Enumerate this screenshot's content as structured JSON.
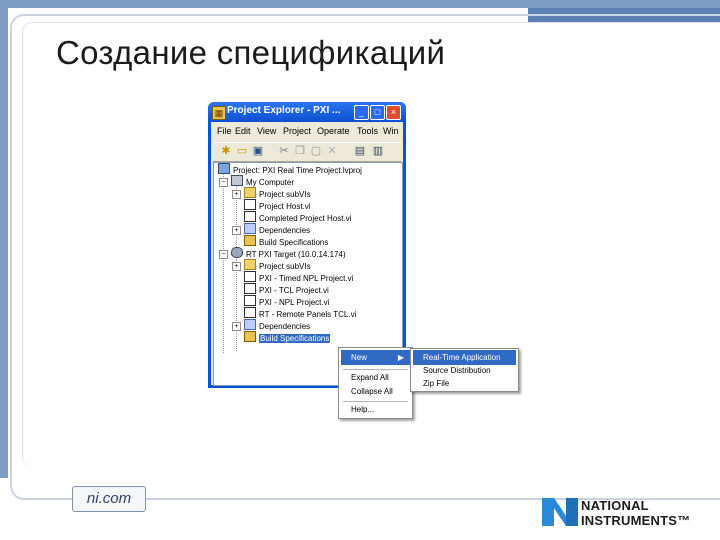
{
  "slide": {
    "title": "Создание спецификаций"
  },
  "window": {
    "title": "Project Explorer - PXI ...",
    "controls": [
      "_",
      "□",
      "×"
    ],
    "menu": [
      "File",
      "Edit",
      "View",
      "Project",
      "Operate",
      "Tools",
      "Win"
    ],
    "toolbar_icons": [
      "new-icon",
      "open-icon",
      "save-all-icon",
      "cut-icon",
      "copy-icon",
      "paste-icon",
      "delete-icon",
      "build-icon",
      "deploy-icon"
    ]
  },
  "tree": {
    "items": [
      {
        "label": "Project: PXI Real Time Project.lvproj",
        "icon": "project-icon"
      },
      {
        "label": "My Computer",
        "icon": "computer-icon"
      },
      {
        "label": "Project subVIs",
        "icon": "folder-icon"
      },
      {
        "label": "Project Host.vi",
        "icon": "vi-icon"
      },
      {
        "label": "Completed Project Host.vi",
        "icon": "vi-icon"
      },
      {
        "label": "Dependencies",
        "icon": "dependencies-icon"
      },
      {
        "label": "Build Specifications",
        "icon": "build-spec-icon"
      },
      {
        "label": "RT PXI Target (10.0.14.174)",
        "icon": "rt-target-icon"
      },
      {
        "label": "Project subVIs",
        "icon": "folder-icon"
      },
      {
        "label": "PXI - Timed NPL Project.vi",
        "icon": "vi-icon"
      },
      {
        "label": "PXI - TCL Project.vi",
        "icon": "vi-icon"
      },
      {
        "label": "PXI - NPL Project.vi",
        "icon": "vi-icon"
      },
      {
        "label": "RT - Remote Panels TCL.vi",
        "icon": "vi-icon"
      },
      {
        "label": "Dependencies",
        "icon": "dependencies-icon"
      },
      {
        "label": "Build Specifications",
        "icon": "build-spec-icon"
      }
    ]
  },
  "context_menu": {
    "items": [
      "New",
      "Expand All",
      "Collapse All",
      "Help..."
    ]
  },
  "submenu": {
    "items": [
      "Real-Time Application",
      "Source Distribution",
      "Zip File"
    ]
  },
  "footer": {
    "site": "ni.com",
    "brand_line1": "NATIONAL",
    "brand_line2": "INSTRUMENTS™"
  },
  "colors": {
    "accent_band": "#7f9cc4",
    "selection": "#316ac5",
    "window_frame": "#0a52d8"
  }
}
